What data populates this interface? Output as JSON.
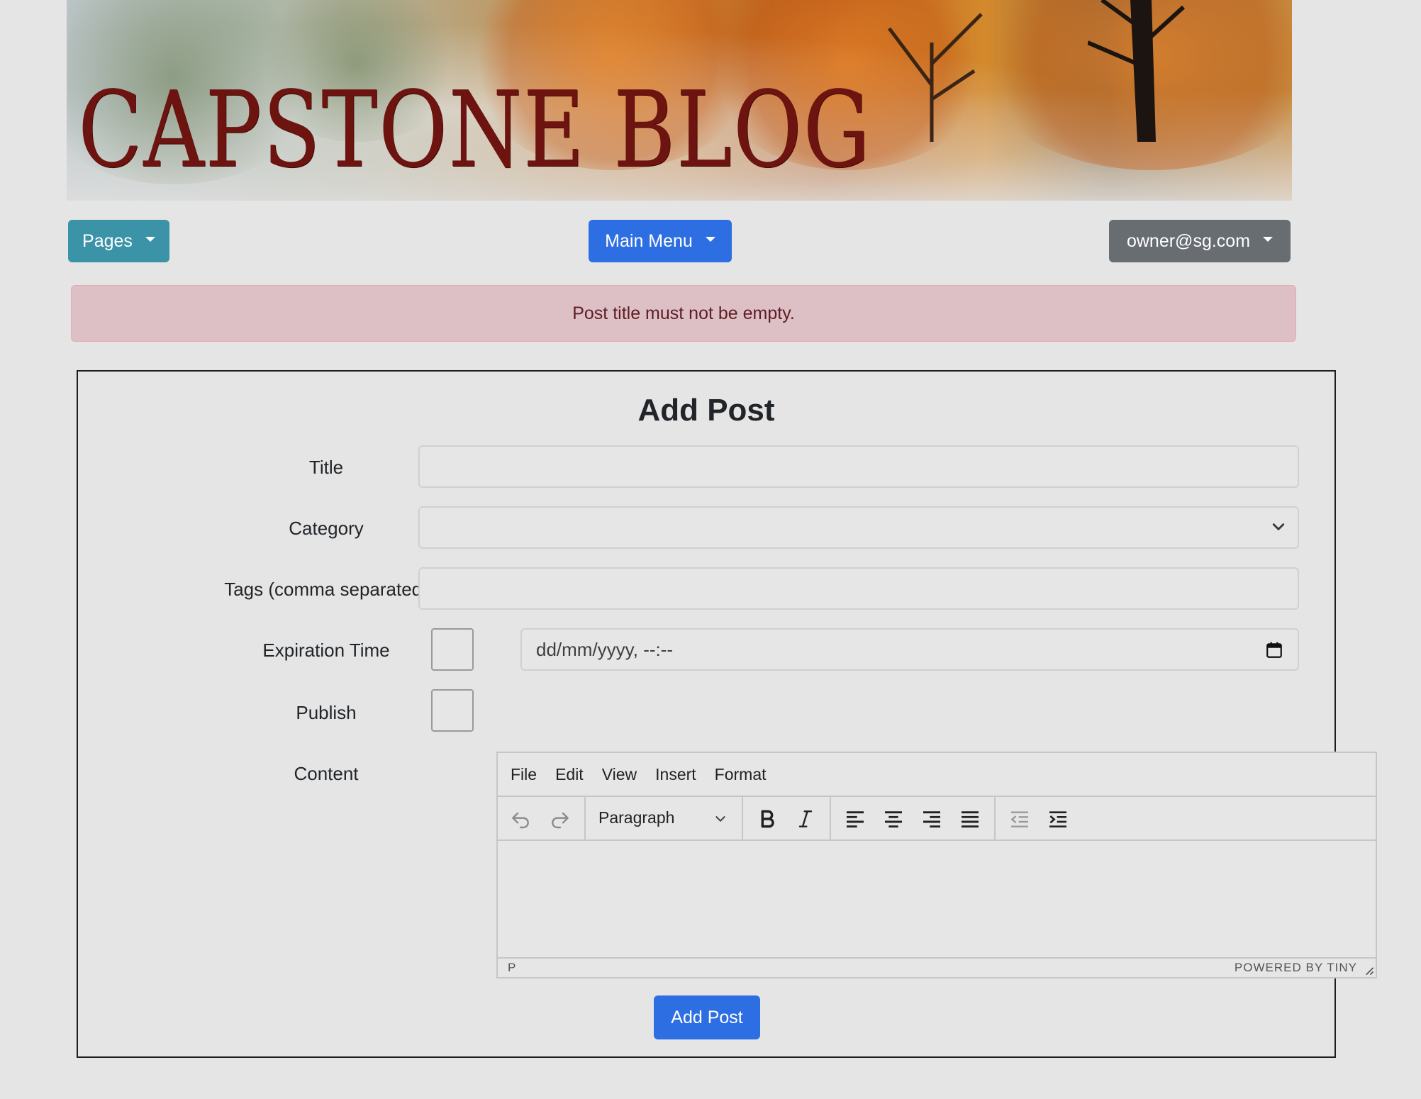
{
  "header": {
    "banner_title": "CAPSTONE BLOG"
  },
  "nav": {
    "pages_label": "Pages",
    "main_menu_label": "Main Menu",
    "user_label": "owner@sg.com"
  },
  "alert": {
    "message": "Post title must not be empty."
  },
  "form": {
    "heading": "Add Post",
    "title_label": "Title",
    "title_value": "",
    "category_label": "Category",
    "category_value": "",
    "tags_label": "Tags (comma separated)",
    "tags_value": "",
    "expiration_label": "Expiration Time",
    "expiration_checked": false,
    "expiration_placeholder": "dd/mm/yyyy, --:--",
    "publish_label": "Publish",
    "publish_checked": false,
    "content_label": "Content",
    "submit_label": "Add Post"
  },
  "editor": {
    "menu": [
      "File",
      "Edit",
      "View",
      "Insert",
      "Format"
    ],
    "block_format": "Paragraph",
    "status_path": "P",
    "brand": "POWERED BY TINY",
    "toolbar_icons": [
      "undo-icon",
      "redo-icon",
      "bold-icon",
      "italic-icon",
      "align-left-icon",
      "align-center-icon",
      "align-right-icon",
      "align-justify-icon",
      "outdent-icon",
      "indent-icon"
    ]
  },
  "colors": {
    "page_bg": "#e5e5e5",
    "pages_button": "#3a93a6",
    "primary": "#2d6fe3",
    "user_button": "#686d72",
    "alert_bg": "#ddc0c5",
    "alert_text": "#5e1d24",
    "banner_title": "#6e1410"
  }
}
